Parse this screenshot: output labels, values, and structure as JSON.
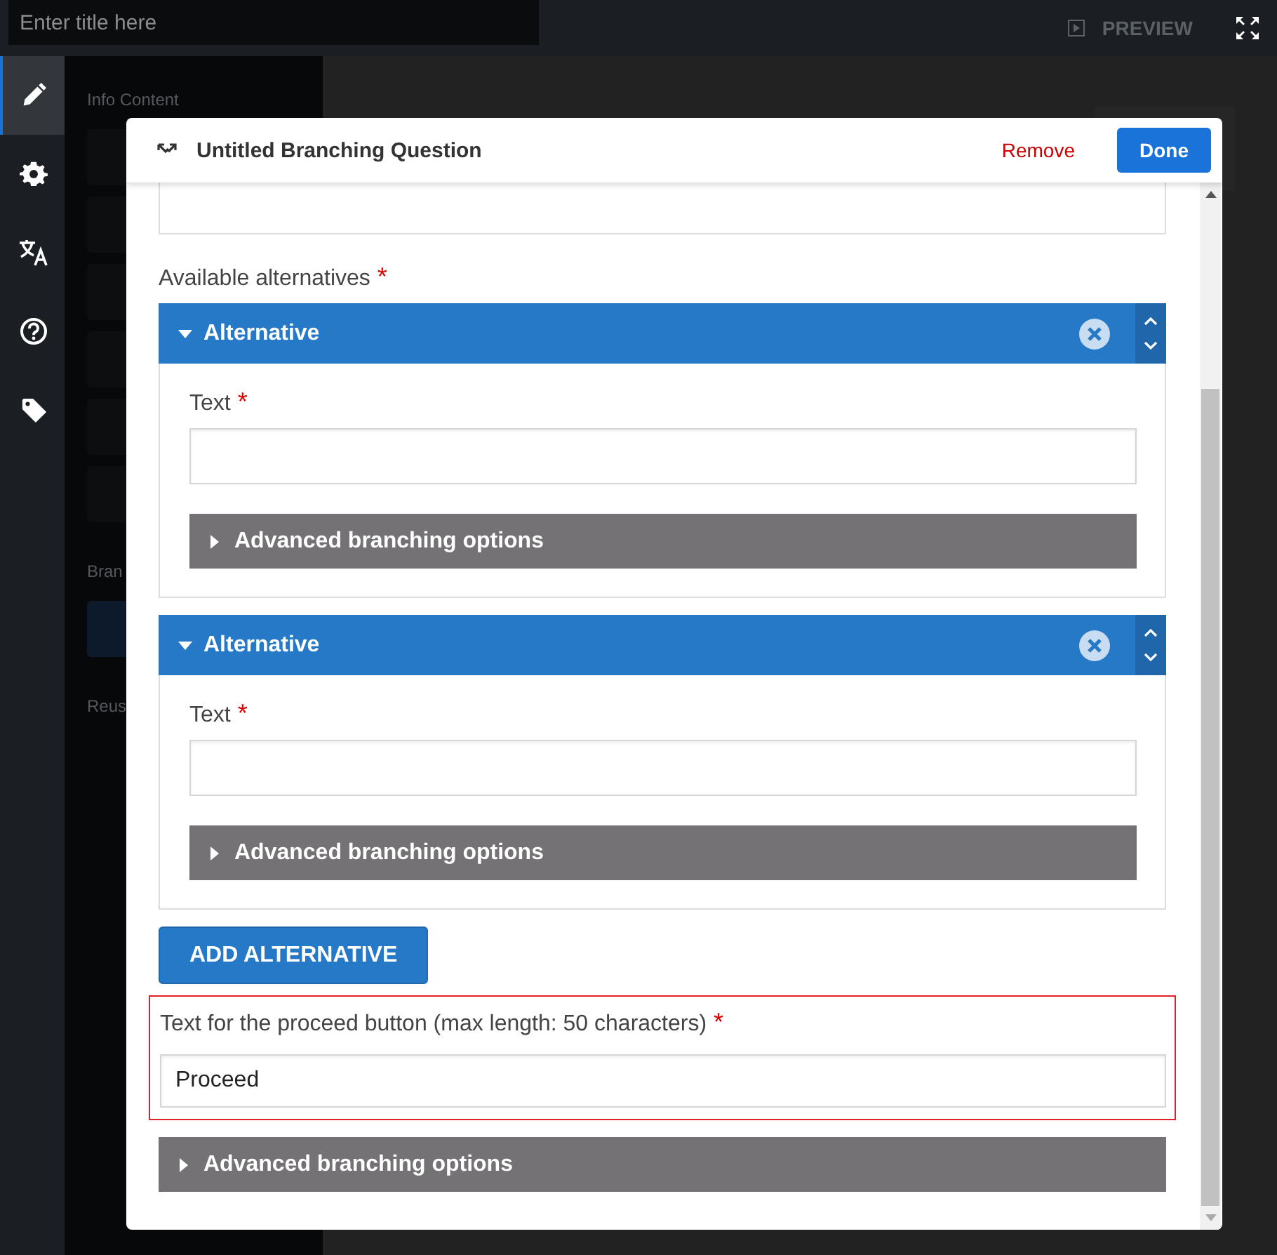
{
  "top_bar": {
    "title_placeholder": "Enter title here",
    "preview": "PREVIEW"
  },
  "sidebar": {
    "items": [
      {
        "kind": "pencil",
        "selected": true
      },
      {
        "kind": "gear",
        "selected": false
      },
      {
        "kind": "translate",
        "selected": false
      },
      {
        "kind": "help",
        "selected": false
      },
      {
        "kind": "tag",
        "selected": false
      }
    ]
  },
  "background": {
    "panel_heading": "Info Content",
    "section_2": "Bran",
    "section_3": "Reus"
  },
  "dialog": {
    "title": "Untitled Branching Question",
    "remove": "Remove",
    "done": "Done",
    "alternatives_label": "Available alternatives",
    "required_mark": "*",
    "alternatives": [
      {
        "title": "Alternative",
        "expanded": true,
        "field_label": "Text",
        "advanced": "Advanced branching options"
      },
      {
        "title": "Alternative",
        "expanded": true,
        "field_label": "Text",
        "advanced": "Advanced branching options"
      }
    ],
    "add_button": "ADD ALTERNATIVE",
    "proceed": {
      "label": "Text for the proceed button (max length: 50 characters)",
      "value": "Proceed",
      "error": true
    },
    "advanced": "Advanced branching options"
  }
}
